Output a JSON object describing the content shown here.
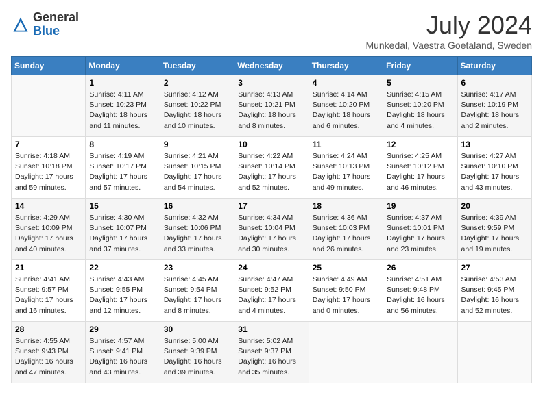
{
  "header": {
    "logo_general": "General",
    "logo_blue": "Blue",
    "month": "July 2024",
    "location": "Munkedal, Vaestra Goetaland, Sweden"
  },
  "days_of_week": [
    "Sunday",
    "Monday",
    "Tuesday",
    "Wednesday",
    "Thursday",
    "Friday",
    "Saturday"
  ],
  "weeks": [
    [
      {
        "day": "",
        "info": ""
      },
      {
        "day": "1",
        "info": "Sunrise: 4:11 AM\nSunset: 10:23 PM\nDaylight: 18 hours\nand 11 minutes."
      },
      {
        "day": "2",
        "info": "Sunrise: 4:12 AM\nSunset: 10:22 PM\nDaylight: 18 hours\nand 10 minutes."
      },
      {
        "day": "3",
        "info": "Sunrise: 4:13 AM\nSunset: 10:21 PM\nDaylight: 18 hours\nand 8 minutes."
      },
      {
        "day": "4",
        "info": "Sunrise: 4:14 AM\nSunset: 10:20 PM\nDaylight: 18 hours\nand 6 minutes."
      },
      {
        "day": "5",
        "info": "Sunrise: 4:15 AM\nSunset: 10:20 PM\nDaylight: 18 hours\nand 4 minutes."
      },
      {
        "day": "6",
        "info": "Sunrise: 4:17 AM\nSunset: 10:19 PM\nDaylight: 18 hours\nand 2 minutes."
      }
    ],
    [
      {
        "day": "7",
        "info": "Sunrise: 4:18 AM\nSunset: 10:18 PM\nDaylight: 17 hours\nand 59 minutes."
      },
      {
        "day": "8",
        "info": "Sunrise: 4:19 AM\nSunset: 10:17 PM\nDaylight: 17 hours\nand 57 minutes."
      },
      {
        "day": "9",
        "info": "Sunrise: 4:21 AM\nSunset: 10:15 PM\nDaylight: 17 hours\nand 54 minutes."
      },
      {
        "day": "10",
        "info": "Sunrise: 4:22 AM\nSunset: 10:14 PM\nDaylight: 17 hours\nand 52 minutes."
      },
      {
        "day": "11",
        "info": "Sunrise: 4:24 AM\nSunset: 10:13 PM\nDaylight: 17 hours\nand 49 minutes."
      },
      {
        "day": "12",
        "info": "Sunrise: 4:25 AM\nSunset: 10:12 PM\nDaylight: 17 hours\nand 46 minutes."
      },
      {
        "day": "13",
        "info": "Sunrise: 4:27 AM\nSunset: 10:10 PM\nDaylight: 17 hours\nand 43 minutes."
      }
    ],
    [
      {
        "day": "14",
        "info": "Sunrise: 4:29 AM\nSunset: 10:09 PM\nDaylight: 17 hours\nand 40 minutes."
      },
      {
        "day": "15",
        "info": "Sunrise: 4:30 AM\nSunset: 10:07 PM\nDaylight: 17 hours\nand 37 minutes."
      },
      {
        "day": "16",
        "info": "Sunrise: 4:32 AM\nSunset: 10:06 PM\nDaylight: 17 hours\nand 33 minutes."
      },
      {
        "day": "17",
        "info": "Sunrise: 4:34 AM\nSunset: 10:04 PM\nDaylight: 17 hours\nand 30 minutes."
      },
      {
        "day": "18",
        "info": "Sunrise: 4:36 AM\nSunset: 10:03 PM\nDaylight: 17 hours\nand 26 minutes."
      },
      {
        "day": "19",
        "info": "Sunrise: 4:37 AM\nSunset: 10:01 PM\nDaylight: 17 hours\nand 23 minutes."
      },
      {
        "day": "20",
        "info": "Sunrise: 4:39 AM\nSunset: 9:59 PM\nDaylight: 17 hours\nand 19 minutes."
      }
    ],
    [
      {
        "day": "21",
        "info": "Sunrise: 4:41 AM\nSunset: 9:57 PM\nDaylight: 17 hours\nand 16 minutes."
      },
      {
        "day": "22",
        "info": "Sunrise: 4:43 AM\nSunset: 9:55 PM\nDaylight: 17 hours\nand 12 minutes."
      },
      {
        "day": "23",
        "info": "Sunrise: 4:45 AM\nSunset: 9:54 PM\nDaylight: 17 hours\nand 8 minutes."
      },
      {
        "day": "24",
        "info": "Sunrise: 4:47 AM\nSunset: 9:52 PM\nDaylight: 17 hours\nand 4 minutes."
      },
      {
        "day": "25",
        "info": "Sunrise: 4:49 AM\nSunset: 9:50 PM\nDaylight: 17 hours\nand 0 minutes."
      },
      {
        "day": "26",
        "info": "Sunrise: 4:51 AM\nSunset: 9:48 PM\nDaylight: 16 hours\nand 56 minutes."
      },
      {
        "day": "27",
        "info": "Sunrise: 4:53 AM\nSunset: 9:45 PM\nDaylight: 16 hours\nand 52 minutes."
      }
    ],
    [
      {
        "day": "28",
        "info": "Sunrise: 4:55 AM\nSunset: 9:43 PM\nDaylight: 16 hours\nand 47 minutes."
      },
      {
        "day": "29",
        "info": "Sunrise: 4:57 AM\nSunset: 9:41 PM\nDaylight: 16 hours\nand 43 minutes."
      },
      {
        "day": "30",
        "info": "Sunrise: 5:00 AM\nSunset: 9:39 PM\nDaylight: 16 hours\nand 39 minutes."
      },
      {
        "day": "31",
        "info": "Sunrise: 5:02 AM\nSunset: 9:37 PM\nDaylight: 16 hours\nand 35 minutes."
      },
      {
        "day": "",
        "info": ""
      },
      {
        "day": "",
        "info": ""
      },
      {
        "day": "",
        "info": ""
      }
    ]
  ]
}
